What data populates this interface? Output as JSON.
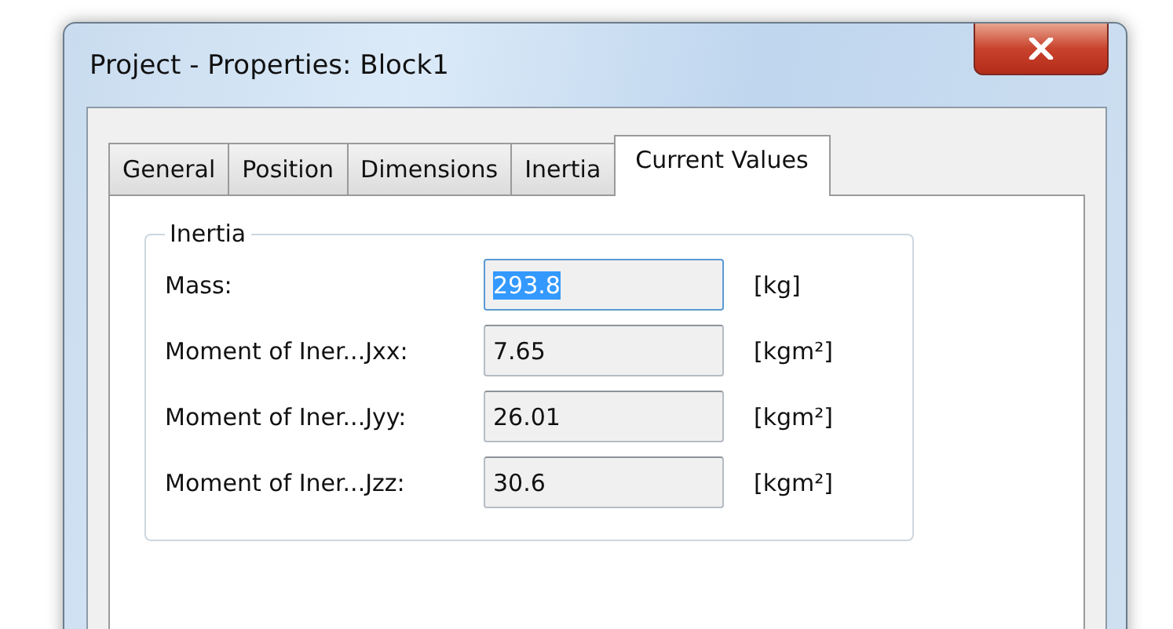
{
  "window": {
    "title": "Project - Properties: Block1"
  },
  "tabs": [
    {
      "label": "General",
      "selected": false
    },
    {
      "label": "Position",
      "selected": false
    },
    {
      "label": "Dimensions",
      "selected": false
    },
    {
      "label": "Inertia",
      "selected": false
    },
    {
      "label": "Current Values",
      "selected": true
    }
  ],
  "group": {
    "title": "Inertia",
    "rows": [
      {
        "label": "Mass:",
        "value": "293.8",
        "focused": true,
        "unit": "[kg]"
      },
      {
        "label": "Moment of Iner...Jxx:",
        "value": "7.65",
        "focused": false,
        "unit": "[kgm²]"
      },
      {
        "label": "Moment of Iner...Jyy:",
        "value": "26.01",
        "focused": false,
        "unit": "[kgm²]"
      },
      {
        "label": "Moment of Iner...Jzz:",
        "value": "30.6",
        "focused": false,
        "unit": "[kgm²]"
      }
    ]
  }
}
